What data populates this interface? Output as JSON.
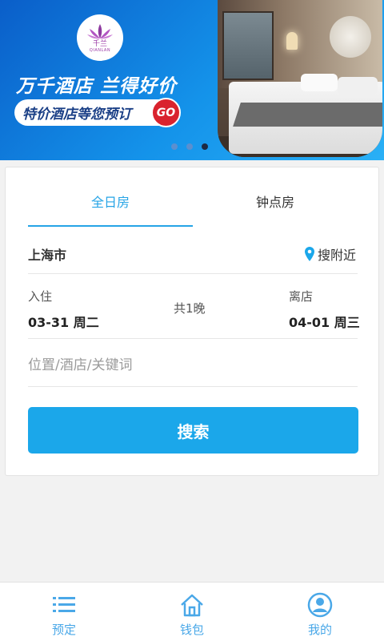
{
  "banner": {
    "logo_cn": "千兰",
    "logo_en": "QIANLAN",
    "slogan": "万千酒店 兰得好价",
    "promo": "特价酒店等您预订",
    "go": "GO",
    "carousel": {
      "total": 3,
      "active_index": 3
    }
  },
  "booking": {
    "tabs": [
      {
        "label": "全日房",
        "active": true
      },
      {
        "label": "钟点房",
        "active": false
      }
    ],
    "city": "上海市",
    "nearby_label": "搜附近",
    "checkin_label": "入住",
    "checkin_date": "03-31 周二",
    "nights": "共1晚",
    "checkout_label": "离店",
    "checkout_date": "04-01 周三",
    "keyword_placeholder": "位置/酒店/关键词",
    "search_label": "搜索"
  },
  "nav": {
    "items": [
      {
        "label": "预定",
        "icon": "list-icon"
      },
      {
        "label": "钱包",
        "icon": "home-icon"
      },
      {
        "label": "我的",
        "icon": "user-icon"
      }
    ]
  },
  "colors": {
    "accent": "#1ba7ea",
    "tab_active": "#26a4e6",
    "promo_go": "#d9232e",
    "nav_label": "#4aa8e8"
  }
}
